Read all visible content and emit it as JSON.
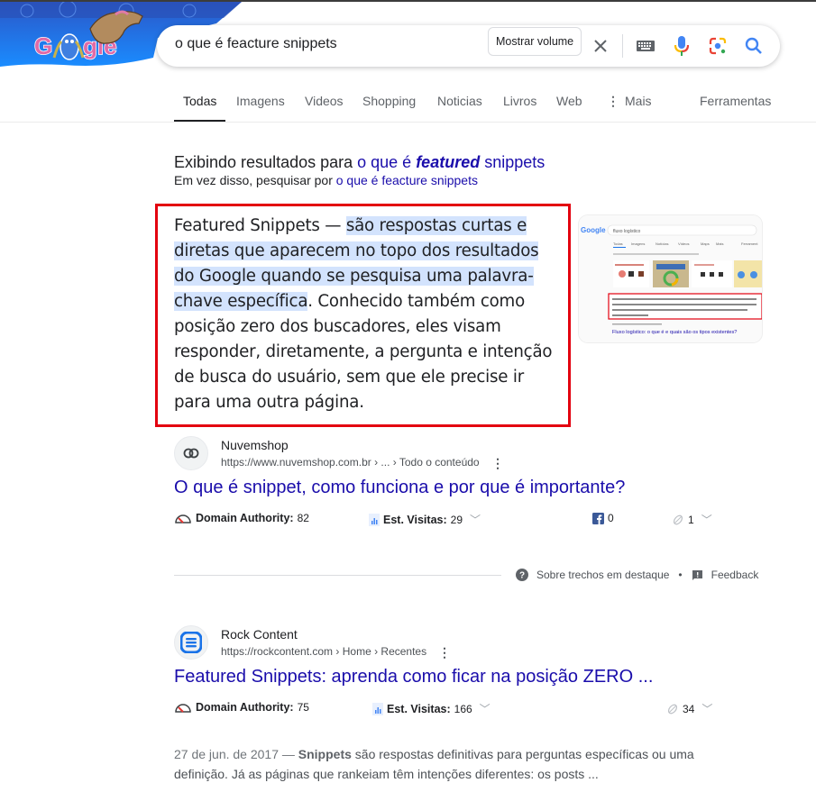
{
  "header": {
    "logo_alt": "Google Doodle",
    "search_query": "o que é feacture snippets",
    "volume_button": "Mostrar volume",
    "icons": [
      "close-icon",
      "keyboard-icon",
      "microphone-icon",
      "google-lens-icon",
      "search-icon"
    ]
  },
  "tabs": [
    {
      "label": "Todas",
      "active": true
    },
    {
      "label": "Imagens"
    },
    {
      "label": "Videos"
    },
    {
      "label": "Shopping"
    },
    {
      "label": "Noticias"
    },
    {
      "label": "Livros"
    },
    {
      "label": "Web"
    },
    {
      "label": "Mais",
      "icon": "more-vert-icon"
    },
    {
      "label": "Ferramentas"
    }
  ],
  "spelling": {
    "showing_prefix": "Exibindo resultados para ",
    "corrected_a": "o que é ",
    "corrected_b": "featured",
    "corrected_c": " snippets",
    "instead_prefix": "Em vez disso, pesquisar por ",
    "original_query": "o que é feacture snippets"
  },
  "featured_snippet": {
    "lead": "Featured Snippets — ",
    "highlight": "são respostas curtas e diretas que aparecem no topo dos resultados do Google quando se pesquisa uma palavra-chave específica",
    "rest": ". Conhecido também como posição zero dos buscadores, eles visam responder, diretamente, a pergunta e intenção de busca do usuário, sem que ele precise ir para uma outra página.",
    "thumbnail": {
      "search_text": "fluxo logístico",
      "link_title": "Fluxo logístico: o que é e quais são os tipos existentes?"
    }
  },
  "results": [
    {
      "site_name": "Nuvemshop",
      "url": "https://www.nuvemshop.com.br",
      "crumbs": " › ... › Todo o conteúdo",
      "title": "O que é snippet, como funciona e por que é importante?",
      "domain_authority_label": "Domain Authority:",
      "domain_authority": "82",
      "visits_label": "Est. Visitas:",
      "visits": "29",
      "facebook": "0",
      "links": "1"
    },
    {
      "site_name": "Rock Content",
      "url": "https://rockcontent.com",
      "crumbs": " › Home › Recentes",
      "title": "Featured Snippets: aprenda como ficar na posição ZERO ...",
      "domain_authority_label": "Domain Authority:",
      "domain_authority": "75",
      "visits_label": "Est. Visitas:",
      "visits": "166",
      "links": "34",
      "date": "27 de jun. de 2017 — ",
      "desc_bold": "Snippets",
      "desc_rest": " são respostas definitivas para perguntas específicas ou uma definição. Já as páginas que rankeiam têm intenções diferentes: os posts ..."
    }
  ],
  "snippet_footer": {
    "about": "Sobre trechos em destaque",
    "dot": "•",
    "feedback": "Feedback"
  },
  "colors": {
    "link": "#1a0dab",
    "highlight": "#d3e3fd",
    "red_outline": "#e3000f"
  }
}
